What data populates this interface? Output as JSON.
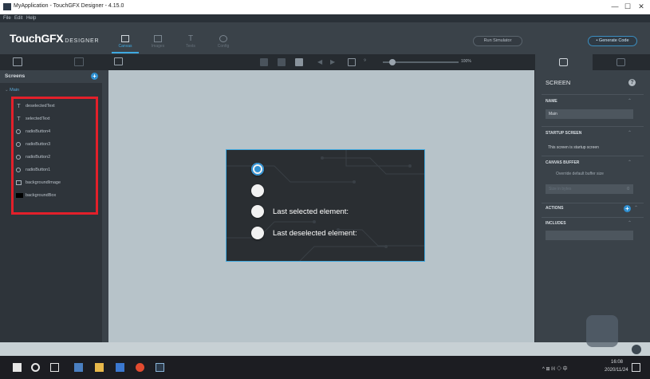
{
  "window": {
    "title": "MyApplication - TouchGFX Designer - 4.15.0",
    "minimize_glyph": "—",
    "maximize_glyph": "☐",
    "close_glyph": "✕"
  },
  "menu": {
    "items": [
      "File",
      "Edit",
      "Help"
    ]
  },
  "toolbar": {
    "logo_main": "TouchGFX",
    "logo_sub": "DESIGNER",
    "tabs": [
      {
        "label": "Canvas",
        "icon": "canvas-icon"
      },
      {
        "label": "Images",
        "icon": "images-icon"
      },
      {
        "label": "Texts",
        "icon": "texts-icon"
      },
      {
        "label": "Config",
        "icon": "config-icon"
      }
    ],
    "run_simulator": "Run Simulator",
    "generate_code": "• Generate Code"
  },
  "canvas_toolbar": {
    "zoom": "100%"
  },
  "left_panel": {
    "header": "Screens",
    "add_glyph": "+",
    "screen_name": "Main",
    "widgets": [
      {
        "name": "deselectedText",
        "icon": "text-icon"
      },
      {
        "name": "selectedText",
        "icon": "text-icon"
      },
      {
        "name": "radioButton4",
        "icon": "radio-icon"
      },
      {
        "name": "radioButton3",
        "icon": "radio-icon"
      },
      {
        "name": "radioButton2",
        "icon": "radio-icon"
      },
      {
        "name": "radioButton1",
        "icon": "radio-icon"
      },
      {
        "name": "backgroundImage",
        "icon": "image-icon"
      },
      {
        "name": "backgroundBox",
        "icon": "box-icon"
      }
    ],
    "text_glyph": "T"
  },
  "design_screen": {
    "label_selected": "Last selected element:",
    "label_deselected": "Last deselected element:"
  },
  "right_panel": {
    "title": "SCREEN",
    "help_glyph": "?",
    "name_header": "NAME",
    "name_value": "Main",
    "startup_header": "STARTUP SCREEN",
    "startup_text": "This screen is startup screen",
    "canvas_buffer_header": "CANVAS BUFFER",
    "canvas_buffer_text": "Override default buffer size",
    "buffer_placeholder": "Size in bytes",
    "buffer_value": "0",
    "actions_header": "ACTIONS",
    "includes_header": "INCLUDES"
  },
  "taskbar": {
    "time": "16:08",
    "date": "2020/11/24",
    "tray_text": "^ ⊞ ℍ ◇ 中"
  }
}
